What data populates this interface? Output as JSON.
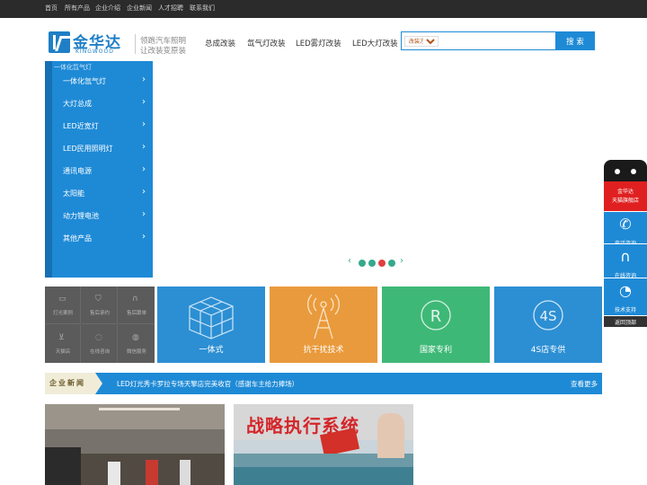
{
  "topnav": [
    "首页",
    "所有产品",
    "企业介绍",
    "企业新闻",
    "人才招聘",
    "联系我们"
  ],
  "logo": {
    "cn": "金华达",
    "en": "KINGWOOD"
  },
  "slogan": [
    "领跑汽车照明",
    "让改装变原装"
  ],
  "mainnav": [
    "总成改装",
    "氙气灯改装",
    "LED雾灯改装",
    "LED大灯改装"
  ],
  "search": {
    "category": "改装方案",
    "placeholder": "",
    "button": "搜 索"
  },
  "menu": {
    "alt_text": "一体化氙气灯",
    "items": [
      "一体化氙气灯",
      "大灯总成",
      "LED近宽灯",
      "LED民用照明灯",
      "通讯电源",
      "太阳能",
      "动力锂电池",
      "其他产品"
    ]
  },
  "slider": {
    "count": 4,
    "active_index": 2
  },
  "services": [
    {
      "icon": "case-icon",
      "label": "灯光案例"
    },
    {
      "icon": "shield-icon",
      "label": "售后承约"
    },
    {
      "icon": "headset-icon",
      "label": "售后跟单"
    },
    {
      "icon": "cart-icon",
      "label": "天猫店"
    },
    {
      "icon": "chat-icon",
      "label": "在线咨询"
    },
    {
      "icon": "wechat-icon",
      "label": "微信服务"
    }
  ],
  "tiles": [
    {
      "label": "一体式",
      "color": "#2c8fd3",
      "icon": "cube-icon"
    },
    {
      "label": "抗干扰技术",
      "color": "#e99a3c",
      "icon": "antenna-icon"
    },
    {
      "label": "国家专利",
      "color": "#3eb877",
      "icon": "registered-icon",
      "glyph": "R"
    },
    {
      "label": "4S店专供",
      "color": "#2c8fd3",
      "icon": "badge-4s-icon",
      "glyph": "4S"
    }
  ],
  "news": {
    "tag": "企业新闻",
    "headline": "LED灯光秀卡罗拉专场天擎店完美收官（感谢车主给力捧场）",
    "more": "查看更多"
  },
  "photo2_banner": "战略执行系统",
  "sidebar": {
    "tmall": [
      "金华达",
      "天猫旗舰店"
    ],
    "phone": "电话咨询",
    "online": "在线咨询",
    "support": "技术支持",
    "top": "返回顶部"
  }
}
